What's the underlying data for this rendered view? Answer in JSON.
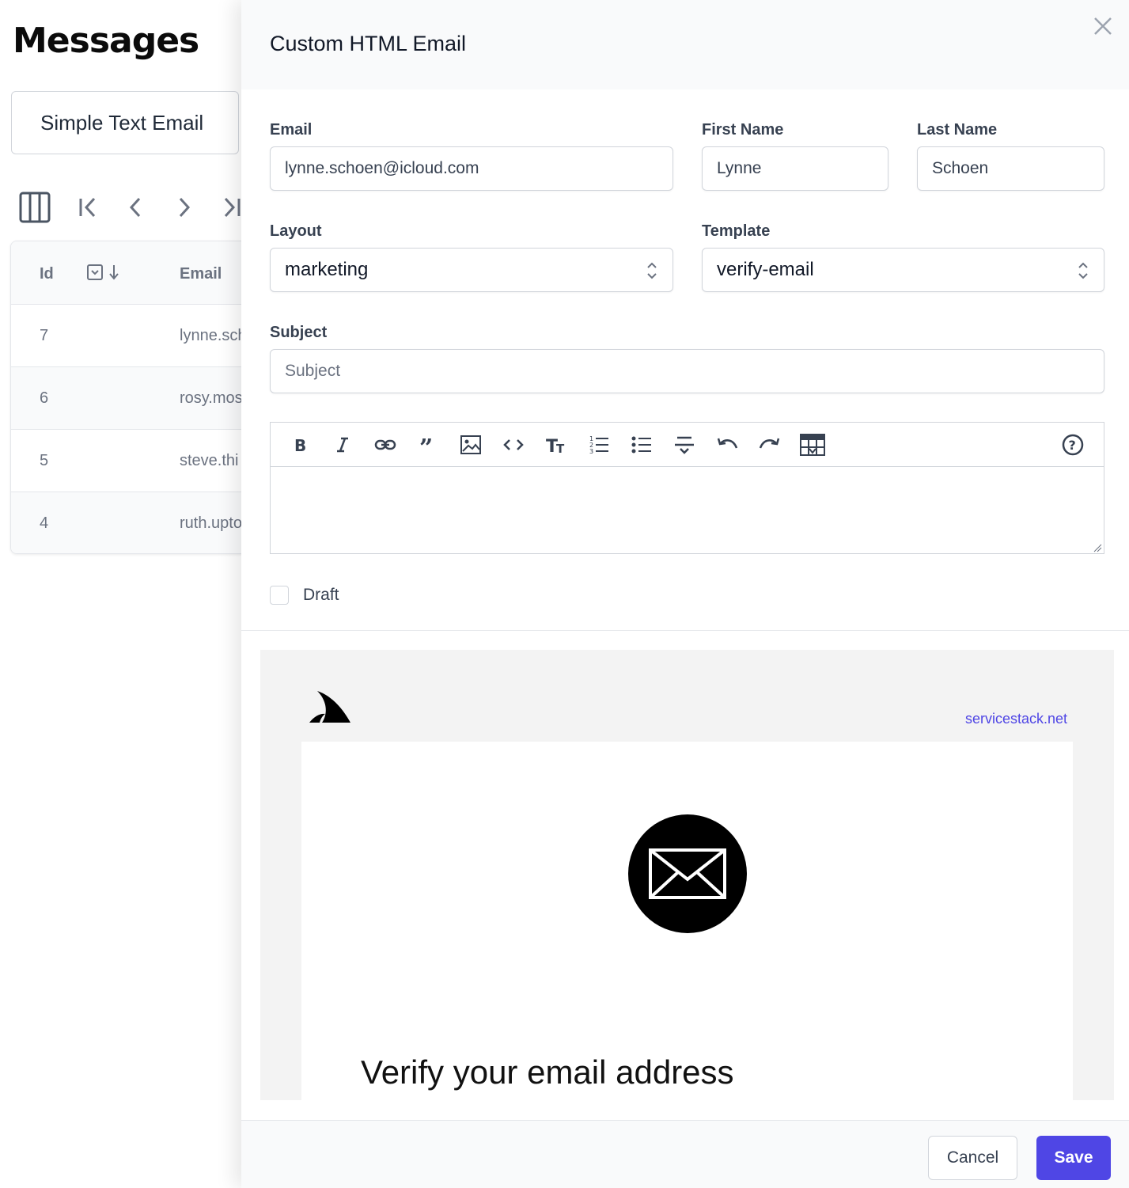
{
  "page": {
    "title": "Messages",
    "tab_label": "Simple Text Email"
  },
  "grid": {
    "columns": [
      "Id",
      "Email"
    ],
    "rows": [
      {
        "id": "7",
        "email": "lynne.sch"
      },
      {
        "id": "6",
        "email": "rosy.mos"
      },
      {
        "id": "5",
        "email": "steve.thi"
      },
      {
        "id": "4",
        "email": "ruth.upto"
      }
    ]
  },
  "panel": {
    "title": "Custom HTML Email",
    "fields": {
      "email": {
        "label": "Email",
        "value": "lynne.schoen@icloud.com"
      },
      "first_name": {
        "label": "First Name",
        "value": "Lynne"
      },
      "last_name": {
        "label": "Last Name",
        "value": "Schoen"
      },
      "layout": {
        "label": "Layout",
        "value": "marketing"
      },
      "template": {
        "label": "Template",
        "value": "verify-email"
      },
      "subject": {
        "label": "Subject",
        "value": "",
        "placeholder": "Subject"
      }
    },
    "draft_label": "Draft",
    "toolbar_icons": [
      "bold-icon",
      "italic-icon",
      "link-icon",
      "quote-icon",
      "image-icon",
      "code-icon",
      "heading-icon",
      "ordered-list-icon",
      "unordered-list-icon",
      "strikethrough-icon",
      "undo-icon",
      "redo-icon",
      "insert-table-icon",
      "help-icon"
    ],
    "preview": {
      "link": "servicestack.net",
      "heading": "Verify your email address"
    },
    "buttons": {
      "cancel": "Cancel",
      "save": "Save"
    }
  },
  "colors": {
    "accent": "#4f46e5",
    "link": "#4f46e5",
    "preview_bg": "#f3f3f3"
  }
}
